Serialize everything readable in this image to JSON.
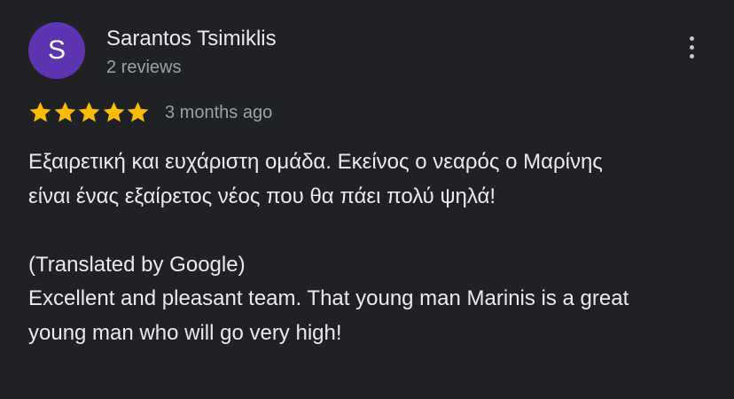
{
  "review": {
    "avatar_initial": "S",
    "author_name": "Sarantos Tsimiklis",
    "review_count": "2 reviews",
    "rating": 5,
    "rating_max": 5,
    "time_ago": "3 months ago",
    "original_text": "Εξαιρετική και ευχάριστη ομάδα. Εκείνος ο νεαρός ο Μαρίνης είναι ένας εξαίρετος νέος που θα πάει πολύ ψηλά!",
    "translation_label": "(Translated by Google)",
    "translated_text": "Excellent and pleasant team. That young man Marinis is a great young man who will go very high!"
  },
  "icons": {
    "more": "more-vert-icon",
    "star": "star-icon"
  },
  "colors": {
    "background": "#202124",
    "avatar": "#5e35b1",
    "star": "#fbbc04",
    "primary_text": "#e8eaed",
    "secondary_text": "#9aa0a6"
  }
}
